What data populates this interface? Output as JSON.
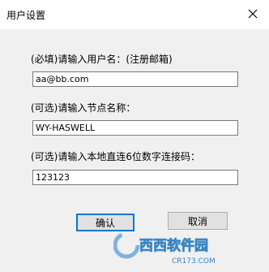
{
  "window": {
    "title": "用户设置"
  },
  "form": {
    "username": {
      "label": "(必填)请输入用户名：(注册邮箱)",
      "value": "aa@bb.com"
    },
    "node": {
      "label": "(可选)请输入节点名称：",
      "value": "WY-HASWELL"
    },
    "code": {
      "label": "(可选)请输入本地直连6位数字连接码：",
      "value": "123123"
    }
  },
  "buttons": {
    "confirm": "确认",
    "cancel": "取消"
  },
  "watermark": {
    "brand": "西西软件园",
    "url": "CR173.COM"
  }
}
